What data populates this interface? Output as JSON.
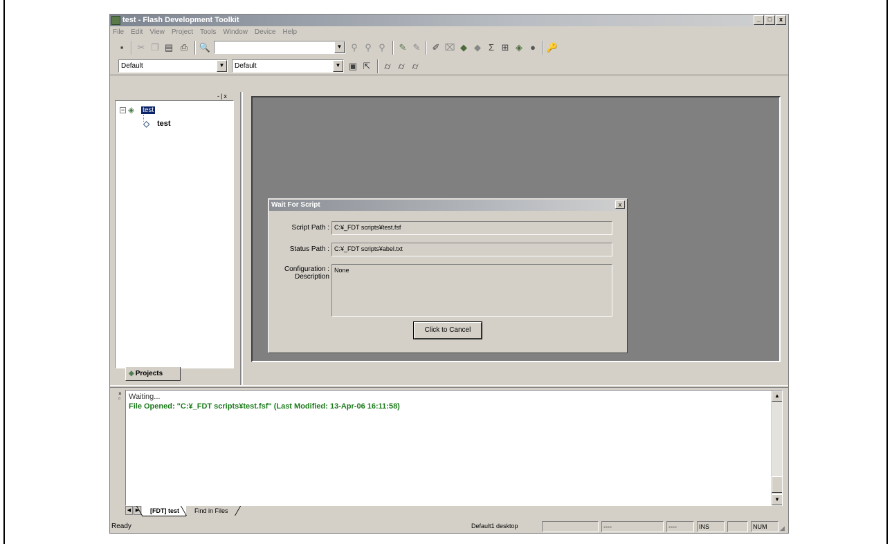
{
  "window": {
    "title": "test - Flash Development Toolkit",
    "controls": [
      "_",
      "□",
      "x"
    ]
  },
  "menu": [
    "File",
    "Edit",
    "View",
    "Project",
    "Tools",
    "Window",
    "Device",
    "Help"
  ],
  "toolbar": {
    "find_value": "",
    "config_combo_1": "Default",
    "config_combo_2": "Default"
  },
  "project_panel": {
    "close_glyphs": "-|x",
    "root_label": "test",
    "child_label": "test",
    "tab_label": "Projects"
  },
  "dialog": {
    "title": "Wait For Script",
    "close": "x",
    "script_path_label": "Script Path :",
    "script_path_value": "C:¥_FDT scripts¥test.fsf",
    "status_path_label": "Status Path :",
    "status_path_value": "C:¥_FDT scripts¥abel.txt",
    "config_label_1": "Configuration :",
    "config_label_2": "Description",
    "config_value": "None",
    "cancel_button": "Click to Cancel"
  },
  "output": {
    "line1": "Waiting...",
    "line2": "File Opened: \"C:¥_FDT scripts¥test.fsf\" (Last Modified: 13-Apr-06 16:11:58)",
    "tabs": [
      "[FDT] test",
      "Find in Files"
    ]
  },
  "statusbar": {
    "ready": "Ready",
    "desktop": "Default1 desktop",
    "pane2": "",
    "pane3": "----",
    "pane4": "----",
    "ins": "INS",
    "pane6": "",
    "num": "NUM"
  }
}
